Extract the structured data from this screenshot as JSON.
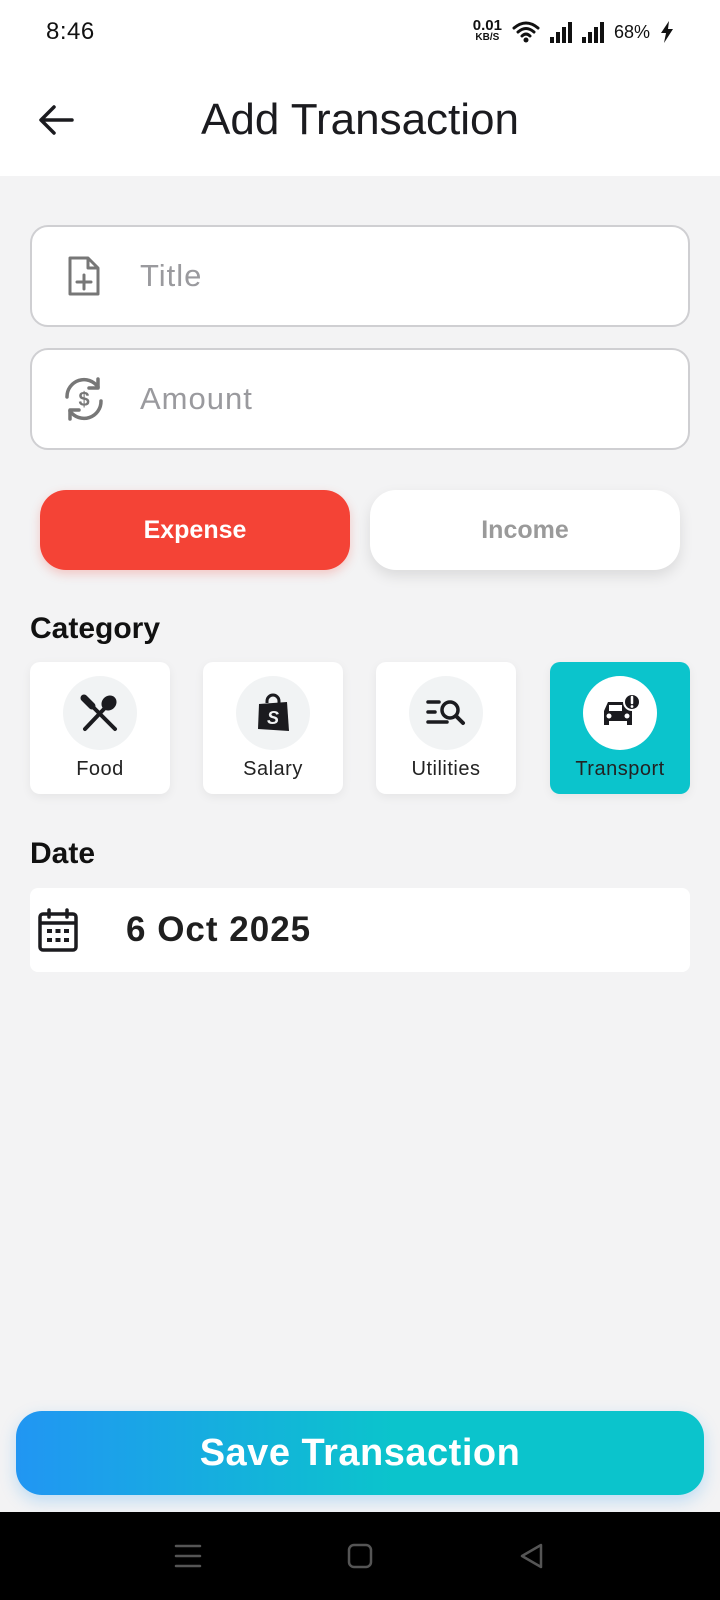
{
  "status_bar": {
    "time": "8:46",
    "net_speed_value": "0.01",
    "net_speed_unit": "KB/S",
    "battery": "68%"
  },
  "app_bar": {
    "title": "Add Transaction",
    "back_icon": "arrow-left-icon"
  },
  "form": {
    "title_placeholder": "Title",
    "title_value": "",
    "title_icon": "file-plus-icon",
    "amount_placeholder": "Amount",
    "amount_value": "",
    "amount_icon": "currency-exchange-icon"
  },
  "type_toggle": {
    "expense_label": "Expense",
    "income_label": "Income",
    "selected": "Expense",
    "expense_color": "#f44336"
  },
  "category": {
    "heading": "Category",
    "items": [
      {
        "label": "Food",
        "icon": "utensils-icon"
      },
      {
        "label": "Salary",
        "icon": "shopping-bag-icon"
      },
      {
        "label": "Utilities",
        "icon": "search-list-icon"
      },
      {
        "label": "Transport",
        "icon": "car-alert-icon"
      }
    ],
    "selected": "Transport",
    "selected_color": "#0bc4cc"
  },
  "date": {
    "heading": "Date",
    "value": "6 Oct 2025",
    "icon": "calendar-icon"
  },
  "save_button": {
    "label": "Save Transaction"
  },
  "nav_bar": {
    "items": [
      "menu-icon",
      "home-square-icon",
      "back-triangle-icon"
    ]
  }
}
